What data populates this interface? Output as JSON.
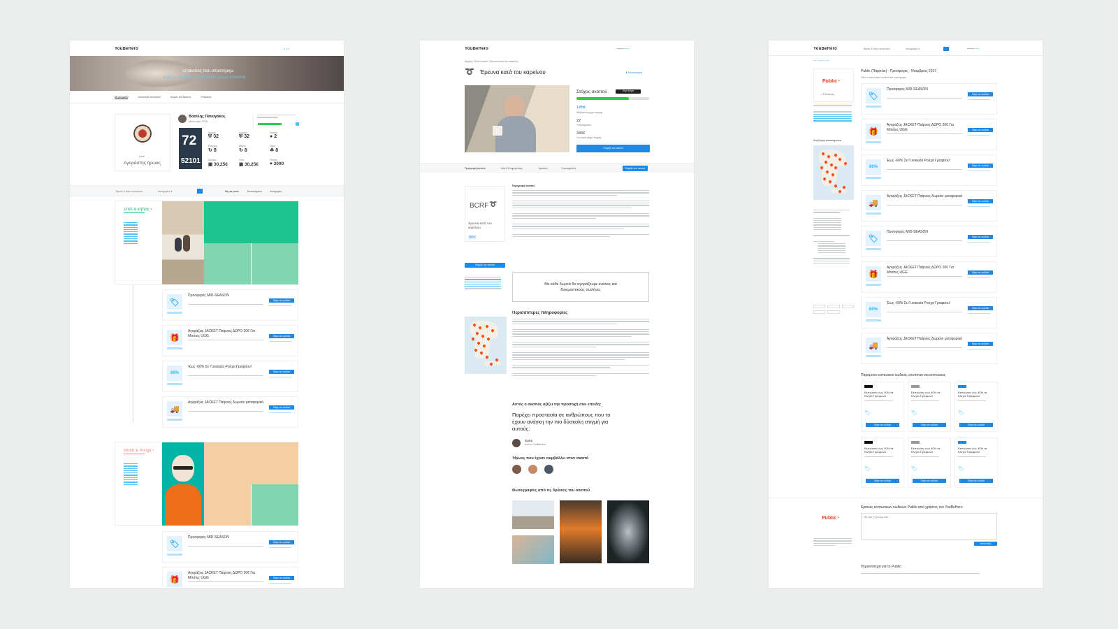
{
  "brand": "YouBeHero",
  "page1": {
    "hero_line1": "Ο σκοπός που υποστηρίζω",
    "hero_line2": "ΕΛΕ.Σ. Δράσεις Προστασίας Ζώων Ελλάδος",
    "tabs": [
      "Με μια ματιά",
      "Αναλυτικά στατιστικά",
      "Αγορές και δράσεις",
      "Ρυθμίσεις"
    ],
    "user_name": "Βασίλης Παναγάκος",
    "user_sub": "Μέλος από: 2016",
    "level_label": "Αγοράστης ήρωας",
    "stat_big": "72",
    "stat_big2": "52101",
    "stats": [
      "32",
      "32",
      "2",
      "8",
      "8",
      "8",
      "30,25€",
      "30,25€",
      "3000"
    ],
    "search_placeholder": "Βρείτε & δείτε εκπτώσεις",
    "filter_tabs": [
      "Με μια ματιά",
      "Καταστήματα",
      "Κατηγορίες"
    ],
    "category1": "Σπίτι & κήπος",
    "category2": "Μόδα & Ρούχα",
    "offers": [
      {
        "title": "Προσφορές MID-SEASON",
        "icon": "tag-icon",
        "glyph": "🏷"
      },
      {
        "title": "Αγοράζεις JACKET Παίρνεις ΔΩΡΟ 20€ Για Μπότες UGG",
        "icon": "gift-icon",
        "glyph": "🎁"
      },
      {
        "title": "Έως -60% Σε Γυναικεία Ρούχα Γραφείου!",
        "icon": "percent-icon",
        "glyph": "60%"
      },
      {
        "title": "Αγοράζεις JACKET Παίρνεις δωρεάν μεταφορικά",
        "icon": "truck-icon",
        "glyph": "🚚"
      }
    ],
    "offer_btn": "Πάρε τον κωδικό",
    "colors": {
      "green": "#1ec48d",
      "green_light": "#7fd6b0",
      "peach": "#f5cfa4",
      "teal": "#00b5a5"
    }
  },
  "page2": {
    "breadcrumb": "Αρχική › Όλοι σκοποί › Έρευνα κατά του καρκίνου",
    "title": "Έρευνα κατά του καρκίνου",
    "goal_label": "Στόχος σκοπού",
    "goal_amount": "185€",
    "supporters": "22",
    "total": "345€",
    "support_btn": "Στήριξε τον σκοπό",
    "tabs": [
      "Περιγραφή σκοπού",
      "Νέα & Ενημερώσεις",
      "Δράσεις",
      "Υποστηρικτές"
    ],
    "org_logo": "BCRF",
    "org_name": "Έρευνα κατά του καρκίνου",
    "quote": "Με κάθε δωρεά θα αγοράζουμε ενέσεις και δοκιμαστικούς σωλήνες",
    "more_info": "Περισσότερες πληροφορίες",
    "why_heading": "Αυτός ο σκοπός αξίζει την προσοχή σου επειδή:",
    "why_text": "Παρέχει προστασία σε ανθρώπους που το έχουν ανάγκη την πιο δύσκολη στιγμή για αυτούς.",
    "signature": "Ερίκη",
    "heroes_heading": "Ήρωες που έχουν συμβάλλει στον σκοπό",
    "photos_heading": "Φωτογραφίες από τις δράσεις του σκοπού"
  },
  "page3": {
    "search_placeholder": "Βρείτε & δείτε εκπτώσεις",
    "store": "Public",
    "heading": "Public (Πάμπλικ) - Προσφορές - Νοέμβριος 2017",
    "offers": [
      {
        "title": "Προσφορές MID-SEASON",
        "icon": "tag-icon",
        "glyph": "🏷"
      },
      {
        "title": "Αγοράζεις JACKET Παίρνεις ΔΩΡΟ 20€ Για Μπότες UGG",
        "icon": "gift-icon",
        "glyph": "🎁"
      },
      {
        "title": "Έως -60% Σε Γυναικεία Ρούχα Γραφείου!",
        "icon": "percent-icon",
        "glyph": "60%"
      },
      {
        "title": "Αγοράζεις JACKET Παίρνεις δωρεάν μεταφορικά",
        "icon": "truck-icon",
        "glyph": "🚚"
      },
      {
        "title": "Προσφορές MID-SEASON",
        "icon": "tag-icon",
        "glyph": "🏷"
      },
      {
        "title": "Αγοράζεις JACKET Παίρνεις ΔΩΡΟ 20€ Για Μπότες UGG",
        "icon": "gift-icon",
        "glyph": "🎁"
      },
      {
        "title": "Έως -60% Σε Γυναικεία Ρούχα Γραφείου!",
        "icon": "percent-icon",
        "glyph": "60%"
      },
      {
        "title": "Αγοράζεις JACKET Παίρνεις δωρεάν μεταφορικά",
        "icon": "truck-icon",
        "glyph": "🚚"
      }
    ],
    "related_heading": "Παρόμοιοι εκπτωτικοί κωδικοί, κουπόνια και εκπτώσεις",
    "mini_title": "Εκπτώσεις έως 40% σε Κινητά Τηλέφωνα",
    "review_heading": "Κριτικές εκπτωτικών κωδικών Public από χρήστες του YouBeHero",
    "more_heading": "Περισσότερα για το Public"
  }
}
